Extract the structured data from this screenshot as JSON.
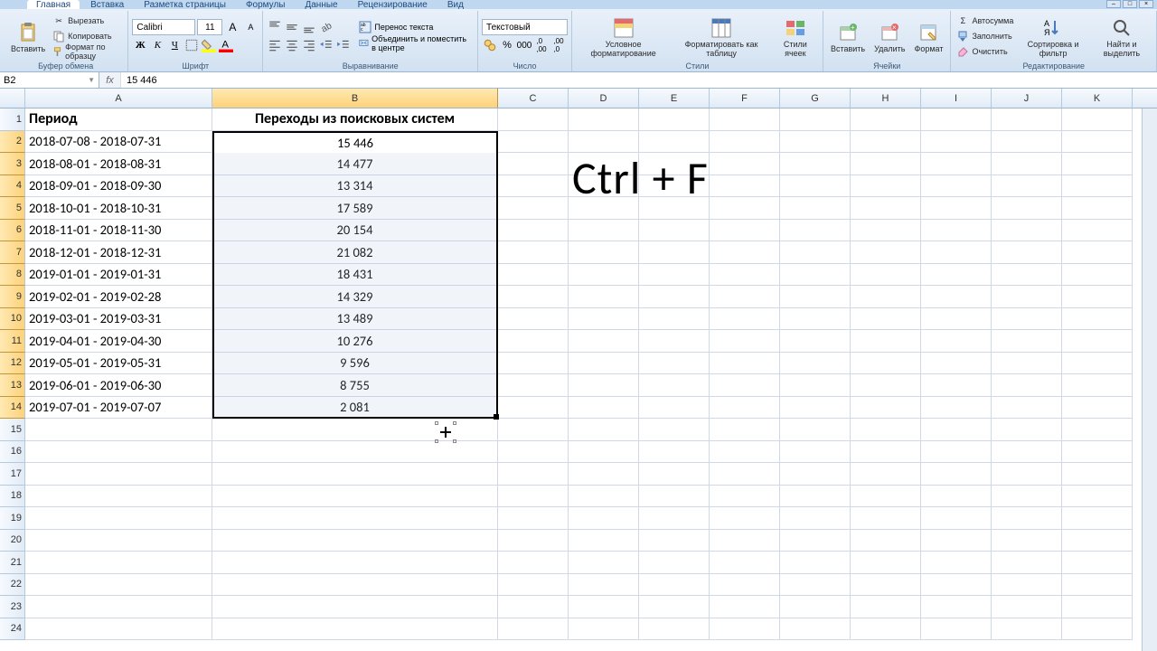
{
  "tabs": [
    "Главная",
    "Вставка",
    "Разметка страницы",
    "Формулы",
    "Данные",
    "Рецензирование",
    "Вид"
  ],
  "active_tab": 0,
  "ribbon": {
    "clipboard": {
      "label": "Буфер обмена",
      "paste": "Вставить",
      "cut": "Вырезать",
      "copy": "Копировать",
      "painter": "Формат по образцу"
    },
    "font": {
      "label": "Шрифт",
      "name": "Calibri",
      "size": "11"
    },
    "alignment": {
      "label": "Выравнивание",
      "wrap": "Перенос текста",
      "merge": "Объединить и поместить в центре"
    },
    "number": {
      "label": "Число",
      "format": "Текстовый"
    },
    "styles": {
      "label": "Стили",
      "cond": "Условное форматирование",
      "table": "Форматировать как таблицу",
      "cell": "Стили ячеек"
    },
    "cells": {
      "label": "Ячейки",
      "insert": "Вставить",
      "delete": "Удалить",
      "format": "Формат"
    },
    "editing": {
      "label": "Редактирование",
      "sum": "Автосумма",
      "fill": "Заполнить",
      "clear": "Очистить",
      "sort": "Сортировка и фильтр",
      "find": "Найти и выделить"
    }
  },
  "name_box": "B2",
  "formula": "15 446",
  "columns": [
    "A",
    "B",
    "C",
    "D",
    "E",
    "F",
    "G",
    "H",
    "I",
    "J",
    "K"
  ],
  "col_widths": {
    "A": 207,
    "B": 316,
    "other": 78
  },
  "headers": {
    "A": "Период",
    "B": "Переходы из поисковых систем"
  },
  "rows": [
    {
      "a": "2018-07-08 - 2018-07-31",
      "b": "15 446"
    },
    {
      "a": "2018-08-01 - 2018-08-31",
      "b": "14 477"
    },
    {
      "a": "2018-09-01 - 2018-09-30",
      "b": "13 314"
    },
    {
      "a": "2018-10-01 - 2018-10-31",
      "b": "17 589"
    },
    {
      "a": "2018-11-01 - 2018-11-30",
      "b": "20 154"
    },
    {
      "a": "2018-12-01 - 2018-12-31",
      "b": "21 082"
    },
    {
      "a": "2019-01-01 - 2019-01-31",
      "b": "18 431"
    },
    {
      "a": "2019-02-01 - 2019-02-28",
      "b": "14 329"
    },
    {
      "a": "2019-03-01 - 2019-03-31",
      "b": "13 489"
    },
    {
      "a": "2019-04-01 - 2019-04-30",
      "b": "10 276"
    },
    {
      "a": "2019-05-01 - 2019-05-31",
      "b": "9 596"
    },
    {
      "a": "2019-06-01 - 2019-06-30",
      "b": "8 755"
    },
    {
      "a": "2019-07-01 - 2019-07-07",
      "b": "2 081"
    }
  ],
  "row_count": 24,
  "selection": {
    "col": "B",
    "row_start": 2,
    "row_end": 14
  },
  "overlay_text": "Ctrl + F",
  "chart_data": {
    "type": "table",
    "title": "Переходы из поисковых систем",
    "columns": [
      "Период",
      "Переходы из поисковых систем"
    ],
    "data": [
      [
        "2018-07-08 - 2018-07-31",
        15446
      ],
      [
        "2018-08-01 - 2018-08-31",
        14477
      ],
      [
        "2018-09-01 - 2018-09-30",
        13314
      ],
      [
        "2018-10-01 - 2018-10-31",
        17589
      ],
      [
        "2018-11-01 - 2018-11-30",
        20154
      ],
      [
        "2018-12-01 - 2018-12-31",
        21082
      ],
      [
        "2019-01-01 - 2019-01-31",
        18431
      ],
      [
        "2019-02-01 - 2019-02-28",
        14329
      ],
      [
        "2019-03-01 - 2019-03-31",
        13489
      ],
      [
        "2019-04-01 - 2019-04-30",
        10276
      ],
      [
        "2019-05-01 - 2019-05-31",
        9596
      ],
      [
        "2019-06-01 - 2019-06-30",
        8755
      ],
      [
        "2019-07-01 - 2019-07-07",
        2081
      ]
    ]
  }
}
